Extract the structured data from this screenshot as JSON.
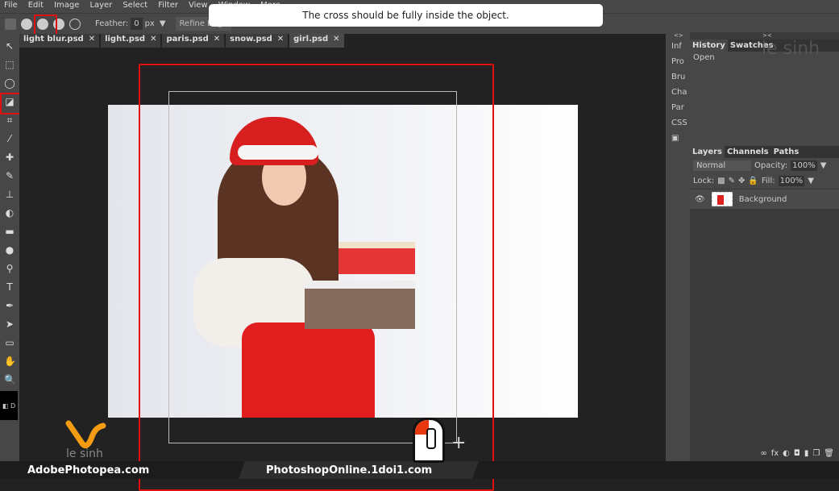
{
  "menu": [
    "File",
    "Edit",
    "Image",
    "Layer",
    "Select",
    "Filter",
    "View",
    "Window",
    "More"
  ],
  "options": {
    "feather_label": "Feather:",
    "feather_value": "0",
    "feather_unit": "px",
    "refine_edge": "Refine Edge"
  },
  "toast": "The cross should be fully inside the object.",
  "tabs": [
    "light blur.psd",
    "light.psd",
    "paris.psd",
    "snow.psd",
    "girl.psd"
  ],
  "tab_close": "✕",
  "side_strip": [
    "Inf",
    "Pro",
    "Bru",
    "Cha",
    "Par",
    "CSS"
  ],
  "history": {
    "tabs": [
      "History",
      "Swatches"
    ],
    "items": [
      "Open"
    ]
  },
  "layers": {
    "tabs": [
      "Layers",
      "Channels",
      "Paths"
    ],
    "blend_mode": "Normal",
    "opacity_label": "Opacity:",
    "opacity": "100%",
    "lock_label": "Lock:",
    "fill_label": "Fill:",
    "fill": "100%",
    "items": [
      {
        "name": "Background",
        "visible": true
      }
    ]
  },
  "watermark": "le sinh",
  "footer": {
    "left": "AdobePhotopea.com",
    "center": "PhotoshopOnline.1doi1.com"
  },
  "colors": {
    "highlight": "#e01010",
    "panel": "#474747",
    "canvas": "#222222",
    "logo": "#f39c12"
  }
}
